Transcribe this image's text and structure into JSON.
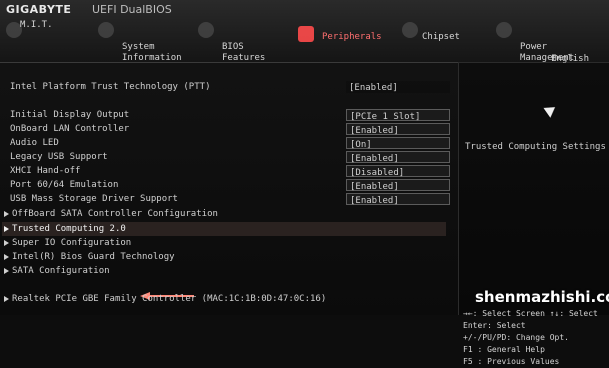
{
  "header": {
    "brand": "GIGABYTE",
    "sub_brand": "UEFI DualBIOS",
    "tabs": [
      {
        "label": "M.I.T.",
        "icon": "mit-icon"
      },
      {
        "label": "System\nInformation",
        "icon": "system-information-icon"
      },
      {
        "label": "BIOS\nFeatures",
        "icon": "bios-features-icon"
      },
      {
        "label": "Peripherals",
        "icon": "peripherals-icon"
      },
      {
        "label": "Chipset",
        "icon": "chipset-icon"
      },
      {
        "label": "Power\nManagement",
        "icon": "power-management-icon"
      }
    ],
    "active_tab": "Peripherals",
    "language": "English"
  },
  "settings": {
    "ptt": {
      "label": "Intel Platform Trust Technology (PTT)",
      "value": "[Enabled]"
    },
    "items": [
      {
        "label": "Initial Display Output",
        "value": "[PCIe 1 Slot]"
      },
      {
        "label": "OnBoard LAN Controller",
        "value": "[Enabled]"
      },
      {
        "label": "Audio LED",
        "value": "[On]"
      },
      {
        "label": "Legacy USB Support",
        "value": "[Enabled]"
      },
      {
        "label": "XHCI Hand-off",
        "value": "[Disabled]"
      },
      {
        "label": "Port 60/64 Emulation",
        "value": "[Enabled]"
      },
      {
        "label": "USB Mass Storage Driver Support",
        "value": "[Enabled]"
      }
    ],
    "submenus": [
      {
        "label": "OffBoard SATA Controller Configuration"
      },
      {
        "label": "Trusted Computing 2.0",
        "selected": true
      },
      {
        "label": "Super IO Configuration"
      },
      {
        "label": "Intel(R) Bios Guard Technology"
      },
      {
        "label": "SATA Configuration"
      }
    ],
    "realtek": "Realtek PCIe GBE Family Controller (MAC:1C:1B:0D:47:0C:16)"
  },
  "help": {
    "title": "Trusted Computing Settings",
    "keys": [
      "→←: Select Screen  ↑↓: Select",
      "Enter: Select",
      "+/-/PU/PD: Change Opt.",
      "F1  : General Help",
      "F5  : Previous Values"
    ]
  },
  "watermark": "shenmazhishi.com",
  "colors": {
    "active_tab": "#ff6f6f",
    "arrow": "#ff8a7a",
    "background": "#0d0d0d",
    "selected_row": "#2a2220"
  }
}
